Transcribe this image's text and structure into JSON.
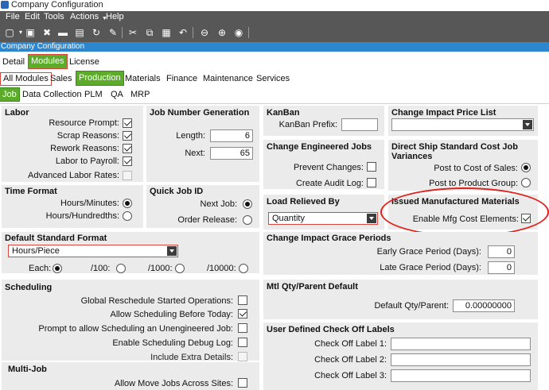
{
  "window": {
    "title": "Company Configuration",
    "band_title": "Company Configuration"
  },
  "menu": [
    "File",
    "Edit",
    "Tools",
    "Actions",
    "Help"
  ],
  "toolbar_icons": [
    "new-icon",
    "save-icon",
    "delete-icon",
    "clear-icon",
    "print-icon",
    "refresh-icon",
    "clear-brush-icon",
    "cut-icon",
    "copy-icon",
    "paste-icon",
    "undo-icon",
    "back-icon",
    "forward-icon",
    "stop-icon"
  ],
  "tabs_top": [
    "Detail",
    "Modules",
    "License"
  ],
  "tabs_modules": [
    "All Modules",
    "Sales",
    "Production",
    "Materials",
    "Finance",
    "Maintenance",
    "Services"
  ],
  "tabs_production": [
    "Job",
    "Data Collection",
    "PLM",
    "QA",
    "MRP"
  ],
  "labor": {
    "title": "Labor",
    "items": [
      {
        "label": "Resource Prompt:",
        "checked": true
      },
      {
        "label": "Scrap Reasons:",
        "checked": true
      },
      {
        "label": "Rework Reasons:",
        "checked": true
      },
      {
        "label": "Labor to Payroll:",
        "checked": true
      },
      {
        "label": "Advanced Labor Rates:",
        "checked": false
      }
    ]
  },
  "job_number": {
    "title": "Job Number Generation",
    "length_label": "Length:",
    "length_value": "6",
    "next_label": "Next:",
    "next_value": "65"
  },
  "time_format": {
    "title": "Time Format",
    "hours_minutes": "Hours/Minutes:",
    "hours_hundredths": "Hours/Hundredths:"
  },
  "quick_job": {
    "title": "Quick Job ID",
    "next_job": "Next Job:",
    "order_release": "Order Release:"
  },
  "kanban": {
    "title": "KanBan",
    "prefix_label": "KanBan Prefix:",
    "prefix_value": ""
  },
  "change_eng": {
    "title": "Change Engineered Jobs",
    "prevent": "Prevent Changes:",
    "audit": "Create Audit Log:"
  },
  "order_relieved": {
    "title": "Load Relieved By",
    "value": "Quantity"
  },
  "change_price": {
    "title": "Change Impact Price List",
    "value": ""
  },
  "direct_ship": {
    "title": "Direct Ship Standard Cost Job Variances",
    "post_sales": "Post to Cost of Sales:",
    "post_product": "Post to Product Group:"
  },
  "issued_mfg": {
    "title": "Issued Manufactured Materials",
    "enable": "Enable Mfg Cost Elements:"
  },
  "default_std": {
    "title": "Default Standard Format",
    "value": "Hours/Piece",
    "each": "Each:",
    "o100": "/100:",
    "o1000": "/1000:",
    "o10000": "/10000:"
  },
  "grace": {
    "title": "Change Impact Grace Periods",
    "early": "Early Grace Period (Days):",
    "early_value": "0",
    "late": "Late Grace Period (Days):",
    "late_value": "0"
  },
  "scheduling": {
    "title": "Scheduling",
    "items": [
      {
        "label": "Global Reschedule Started Operations:",
        "checked": false
      },
      {
        "label": "Allow Scheduling Before Today:",
        "checked": true
      },
      {
        "label": "Prompt to allow Scheduling an Unengineered Job:",
        "checked": false
      },
      {
        "label": "Enable Scheduling Debug Log:",
        "checked": false
      },
      {
        "label": "Include Extra Details:",
        "checked": false
      }
    ]
  },
  "mtl_qty": {
    "title": "Mtl Qty/Parent Default",
    "label": "Default Qty/Parent:",
    "value": "0.00000000"
  },
  "checkoff": {
    "title": "User Defined Check Off Labels",
    "labels": [
      "Check Off Label 1:",
      "Check Off Label 2:",
      "Check Off Label 3:"
    ]
  },
  "multi_job": {
    "title": "Multi-Job",
    "allow": "Allow Move Jobs Across Sites:"
  }
}
